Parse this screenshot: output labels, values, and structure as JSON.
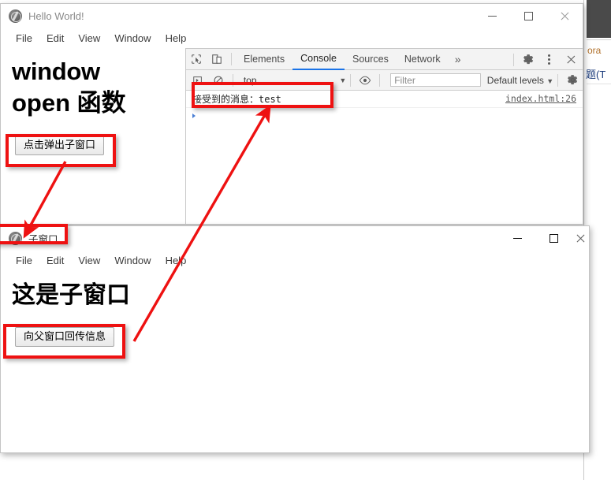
{
  "parent_window": {
    "title": "Hello World!",
    "app_icon": "electron-atom-icon",
    "menu": [
      "File",
      "Edit",
      "View",
      "Window",
      "Help"
    ],
    "controls": {
      "minimize": "minimize-icon",
      "maximize": "maximize-icon",
      "close": "close-icon"
    },
    "heading_line1": "window",
    "heading_line2": "open 函数",
    "button_label": "点击弹出子窗口"
  },
  "devtools": {
    "toolbar_icons": [
      "inspect-element-icon",
      "device-toolbar-icon"
    ],
    "tabs": [
      {
        "label": "Elements",
        "active": false
      },
      {
        "label": "Console",
        "active": true
      },
      {
        "label": "Sources",
        "active": false
      },
      {
        "label": "Network",
        "active": false
      }
    ],
    "more_tabs": "»",
    "right_icons": [
      "settings-gear-icon",
      "more-options-kebab-icon",
      "close-devtools-icon"
    ],
    "filterbar": {
      "execute_icon": "execute-step-icon",
      "clear_icon": "clear-console-icon",
      "context": "top",
      "context_caret": "▼",
      "eye_icon": "live-expression-eye-icon",
      "filter_placeholder": "Filter",
      "levels": "Default levels",
      "levels_caret": "▼",
      "settings_icon": "console-settings-gear-icon"
    },
    "console_message": "接受到的消息：test",
    "console_source": "index.html:26"
  },
  "child_window": {
    "title": "子窗口",
    "app_icon": "electron-atom-icon",
    "menu": [
      "File",
      "Edit",
      "View",
      "Window",
      "Help"
    ],
    "controls": {
      "minimize": "minimize-icon",
      "maximize": "maximize-icon",
      "close": "close-icon"
    },
    "heading": "这是子窗口",
    "button_label": "向父窗口回传信息"
  },
  "background_window": {
    "text_fragment_1": "ora",
    "text_fragment_2": "题(T"
  },
  "annotations": {
    "highlight_color": "#ee1111",
    "boxes": [
      {
        "name": "parent-open-button-highlight"
      },
      {
        "name": "console-message-highlight"
      },
      {
        "name": "child-window-title-highlight"
      },
      {
        "name": "child-send-button-highlight"
      }
    ],
    "arrows": [
      {
        "name": "arrow-open-button-to-child-window"
      },
      {
        "name": "arrow-child-button-to-console-message"
      }
    ]
  }
}
